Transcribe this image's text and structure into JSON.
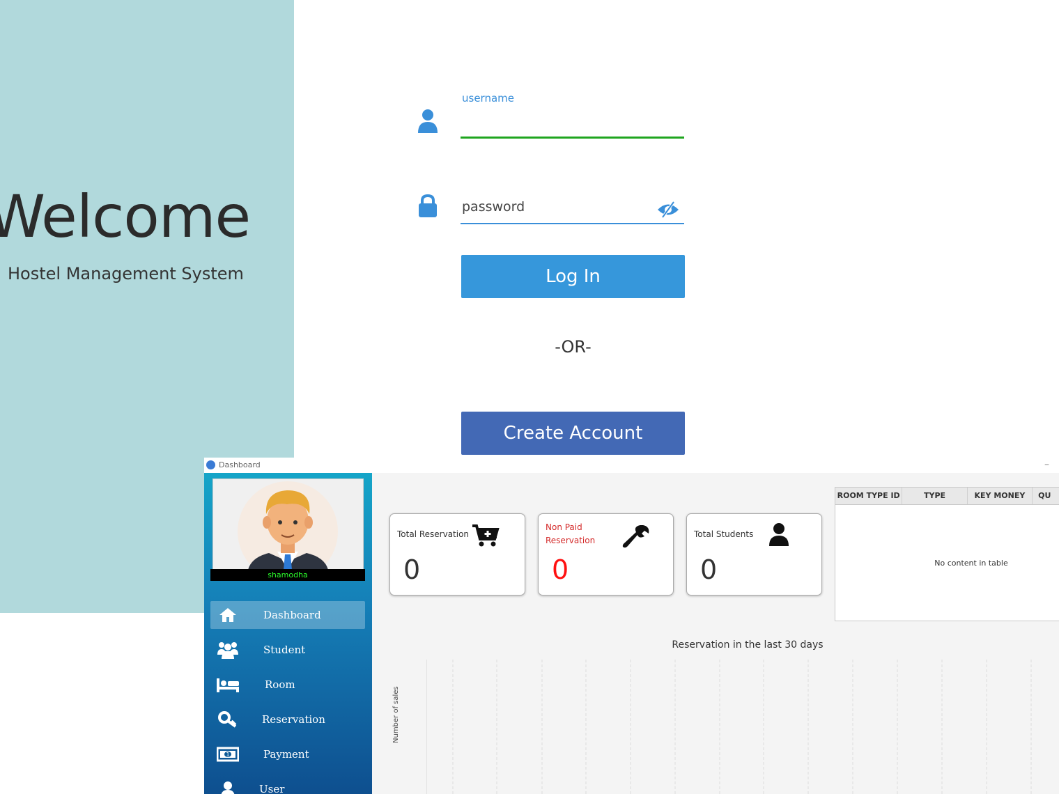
{
  "login": {
    "welcome_title": "Welcome",
    "welcome_subtitle": "Hostel Management System",
    "username_label": "username",
    "password_placeholder": "password",
    "login_button": "Log In",
    "or_text": "-OR-",
    "create_account_button": "Create Account",
    "colors": {
      "left_panel": "#b1d9dc",
      "login_button": "#3697db",
      "create_button": "#4369b5",
      "accent": "#3a8fd9",
      "active_underline": "#1fa51f"
    }
  },
  "dashboard": {
    "window_title": "Dashboard",
    "minimize_glyph": "–",
    "user_name": "shamodha",
    "nav": [
      {
        "label": "Dashboard",
        "icon": "home-icon",
        "active": true
      },
      {
        "label": "Student",
        "icon": "users-icon",
        "active": false
      },
      {
        "label": "Room",
        "icon": "bed-icon",
        "active": false
      },
      {
        "label": "Reservation",
        "icon": "key-icon",
        "active": false
      },
      {
        "label": "Payment",
        "icon": "money-icon",
        "active": false
      },
      {
        "label": "User",
        "icon": "user-icon",
        "active": false
      }
    ],
    "cards": [
      {
        "title": "Total Reservation",
        "value": "0",
        "icon": "cart-plus-icon"
      },
      {
        "title": "Non Paid Reservation",
        "value": "0",
        "icon": "wrench-icon"
      },
      {
        "title": "Total Students",
        "value": "0",
        "icon": "user-icon"
      }
    ],
    "table": {
      "columns": [
        "ROOM TYPE ID",
        "TYPE",
        "KEY MONEY",
        "QU"
      ],
      "empty_message": "No content in table"
    },
    "chart_data": {
      "type": "line",
      "title": "Reservation in the last 30 days",
      "ylabel": "Number of sales",
      "series": [],
      "grid": true
    }
  }
}
